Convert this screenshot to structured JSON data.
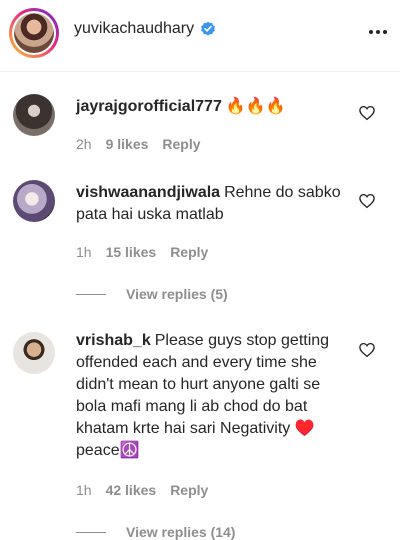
{
  "header": {
    "username": "yuvikachaudhary",
    "verified_icon": "verified-badge-icon",
    "more_icon": "more-horizontal-icon"
  },
  "comments": [
    {
      "username": "jayrajgorofficial777",
      "text": "🔥🔥🔥",
      "time": "2h",
      "likes": "9 likes",
      "reply": "Reply"
    },
    {
      "username": "vishwaanandjiwala",
      "text": "Rehne do sabko pata hai uska matlab",
      "time": "1h",
      "likes": "15 likes",
      "reply": "Reply",
      "view_replies": "View replies (5)"
    },
    {
      "username": "vrishab_k",
      "text": "Please guys stop getting offended each and every time she didn't mean to hurt anyone galti se bola mafi mang li ab chod do bat khatam krte hai sari Negativity ♥️ peace☮️",
      "time": "1h",
      "likes": "42 likes",
      "reply": "Reply",
      "view_replies": "View replies (14)"
    }
  ],
  "colors": {
    "text": "#262626",
    "secondary": "#8e8e8e",
    "verified": "#3897f0",
    "border": "#efefef"
  }
}
